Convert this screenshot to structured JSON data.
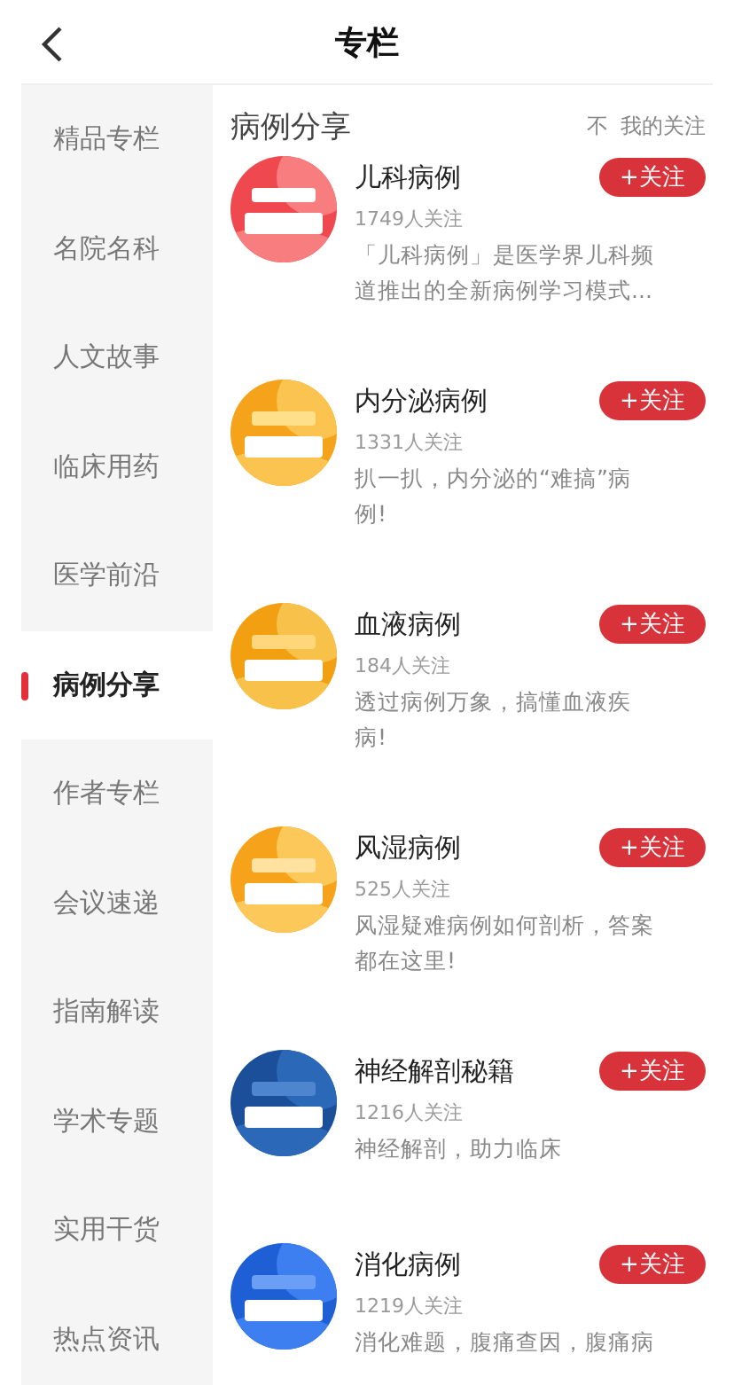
{
  "header": {
    "title": "专栏"
  },
  "sidebar": {
    "items": [
      {
        "label": "精品专栏",
        "selected": false
      },
      {
        "label": "名院名科",
        "selected": false
      },
      {
        "label": "人文故事",
        "selected": false
      },
      {
        "label": "临床用药",
        "selected": false
      },
      {
        "label": "医学前沿",
        "selected": false
      },
      {
        "label": "病例分享",
        "selected": true
      },
      {
        "label": "作者专栏",
        "selected": false
      },
      {
        "label": "会议速递",
        "selected": false
      },
      {
        "label": "指南解读",
        "selected": false
      },
      {
        "label": "学术专题",
        "selected": false
      },
      {
        "label": "实用干货",
        "selected": false
      },
      {
        "label": "热点资讯",
        "selected": false
      }
    ]
  },
  "section": {
    "title": "病例分享",
    "follow_icon": "不",
    "my_follows": "我的关注"
  },
  "columns": [
    {
      "name": "儿科病例",
      "followers": "1749人关注",
      "description": "「儿科病例」是医学界儿科频道推出的全新病例学习模式...",
      "button": "+关注"
    },
    {
      "name": "内分泌病例",
      "followers": "1331人关注",
      "description": "扒一扒，内分泌的“难搞”病例!",
      "button": "+关注"
    },
    {
      "name": "血液病例",
      "followers": "184人关注",
      "description": "透过病例万象，搞懂血液疾病!",
      "button": "+关注"
    },
    {
      "name": "风湿病例",
      "followers": "525人关注",
      "description": "风湿疑难病例如何剖析，答案都在这里!",
      "button": "+关注"
    },
    {
      "name": "神经解剖秘籍",
      "followers": "1216人关注",
      "description": "神经解剖，助力临床",
      "button": "+关注"
    },
    {
      "name": "消化病例",
      "followers": "1219人关注",
      "description": "消化难题，腹痛查因，腹痛病",
      "button": "+关注"
    }
  ]
}
